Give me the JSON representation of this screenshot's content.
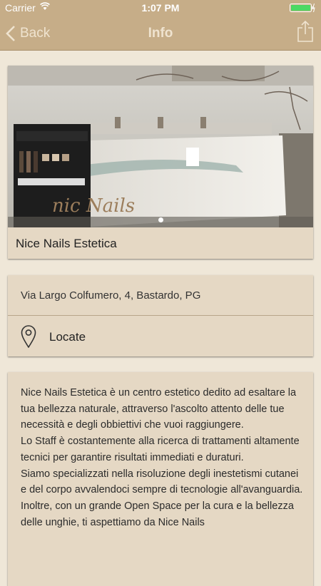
{
  "status_bar": {
    "carrier": "Carrier",
    "time": "1:07 PM"
  },
  "nav": {
    "back_label": "Back",
    "title": "Info",
    "share_icon": "share-icon"
  },
  "gallery": {
    "current_slide": 1,
    "total_slides": 1
  },
  "business": {
    "name": "Nice Nails Estetica",
    "address": "Via Largo Colfumero, 4, Bastardo, PG",
    "locate_label": "Locate"
  },
  "description": [
    "Nice Nails Estetica è un centro estetico dedito ad esaltare la tua bellezza naturale, attraverso l'ascolto attento delle tue necessità e degli obbiettivi che vuoi raggiungere.",
    "Lo Staff è costantemente alla ricerca di trattamenti altamente tecnici per garantire risultati immediati e duraturi.",
    "Siamo specializzati nella risoluzione degli inestetismi cutanei e del corpo avvalendoci sempre di tecnologie all'avanguardia.",
    "Inoltre, con un grande Open Space per la cura e la bellezza delle unghie, ti aspettiamo da Nice Nails"
  ],
  "colors": {
    "bar": "#c6ad88",
    "background": "#efe7d8",
    "card": "#e5d8c4"
  }
}
